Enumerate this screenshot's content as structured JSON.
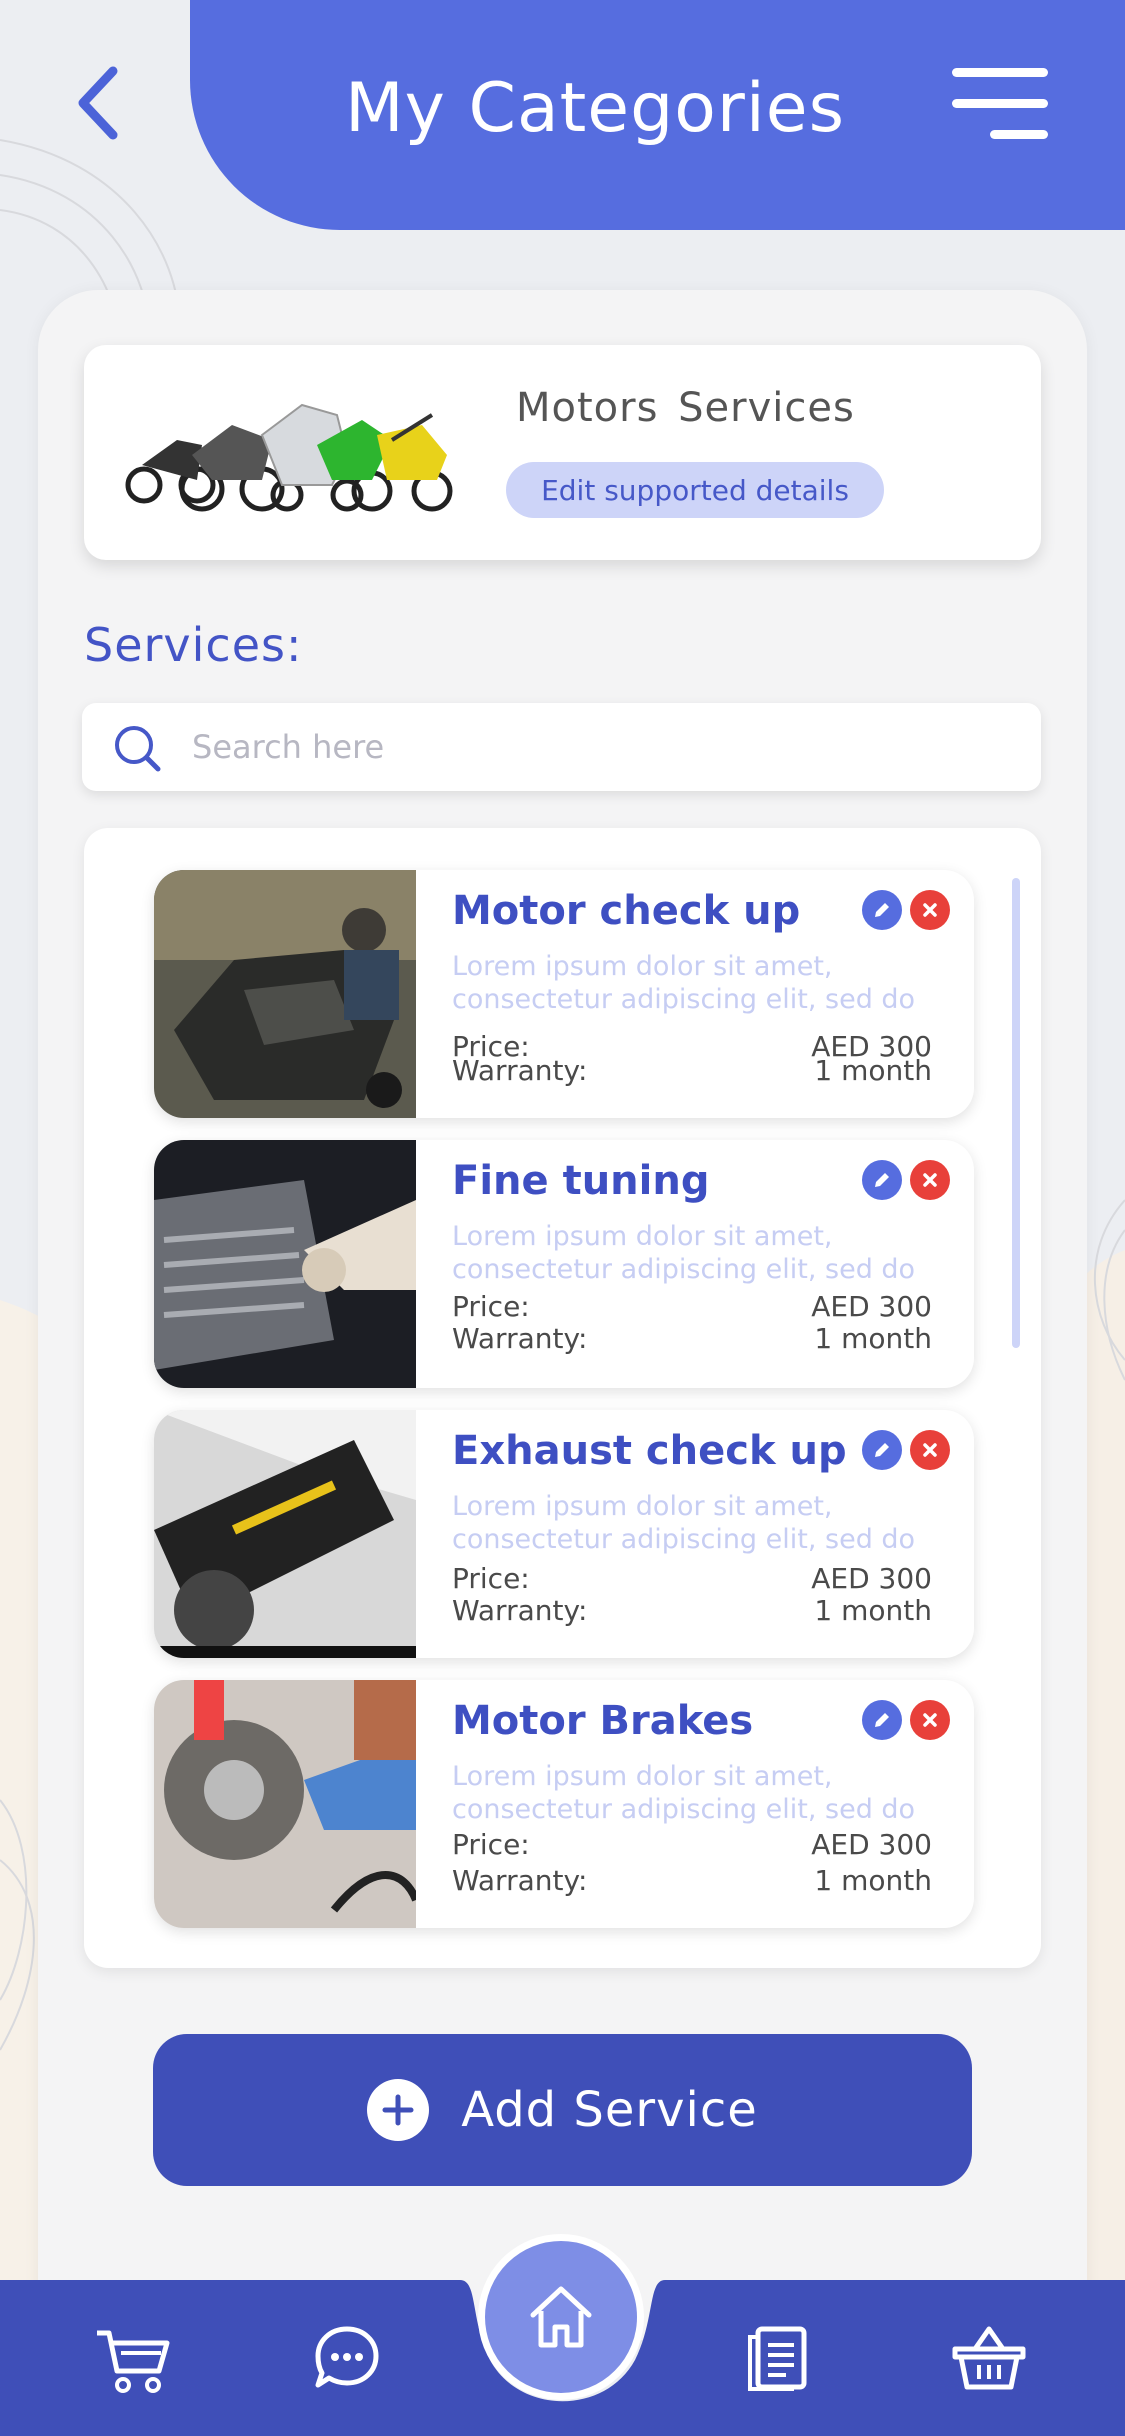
{
  "header": {
    "title": "My Categories",
    "back_icon": "chevron-left-icon",
    "menu_icon": "hamburger-menu-icon"
  },
  "category": {
    "name": "Motors  Services",
    "edit_label": "Edit supported details",
    "image": "motorcycles-group-photo"
  },
  "services": {
    "heading": "Services:",
    "search_placeholder": "Search here",
    "price_label": "Price:",
    "warranty_label": "Warranty:",
    "items": [
      {
        "title": "Motor check up",
        "desc1": "Lorem ipsum dolor sit amet,",
        "desc2": "consectetur adipiscing elit, sed do",
        "price": "AED 300",
        "warranty": "1 month",
        "image": "mechanic-inspecting-motorcycle-photo"
      },
      {
        "title": "Fine tuning",
        "desc1": "Lorem ipsum dolor sit amet,",
        "desc2": "consectetur adipiscing elit, sed do",
        "price": "AED 300",
        "warranty": "1 month",
        "image": "engine-tuning-photo"
      },
      {
        "title": "Exhaust check up",
        "desc1": "Lorem ipsum dolor sit amet,",
        "desc2": "consectetur adipiscing elit, sed do",
        "price": "AED 300",
        "warranty": "1 month",
        "image": "akrapovic-exhaust-photo"
      },
      {
        "title": "Motor Brakes",
        "desc1": "Lorem ipsum dolor sit amet,",
        "desc2": "consectetur adipiscing elit, sed do",
        "price": "AED 300",
        "warranty": "1 month",
        "image": "brake-repair-photo"
      }
    ]
  },
  "add_service": {
    "label": "Add Service",
    "icon": "plus-circle-icon"
  },
  "bottom_nav": {
    "items": [
      "cart-icon",
      "chat-icon",
      "home-icon",
      "documents-icon",
      "basket-icon"
    ]
  },
  "colors": {
    "primary": "#566ddf",
    "dark_primary": "#3f4fb8",
    "title_blue": "#3e4fc2",
    "danger": "#e8403a",
    "light_accent": "#cdd4f8"
  }
}
